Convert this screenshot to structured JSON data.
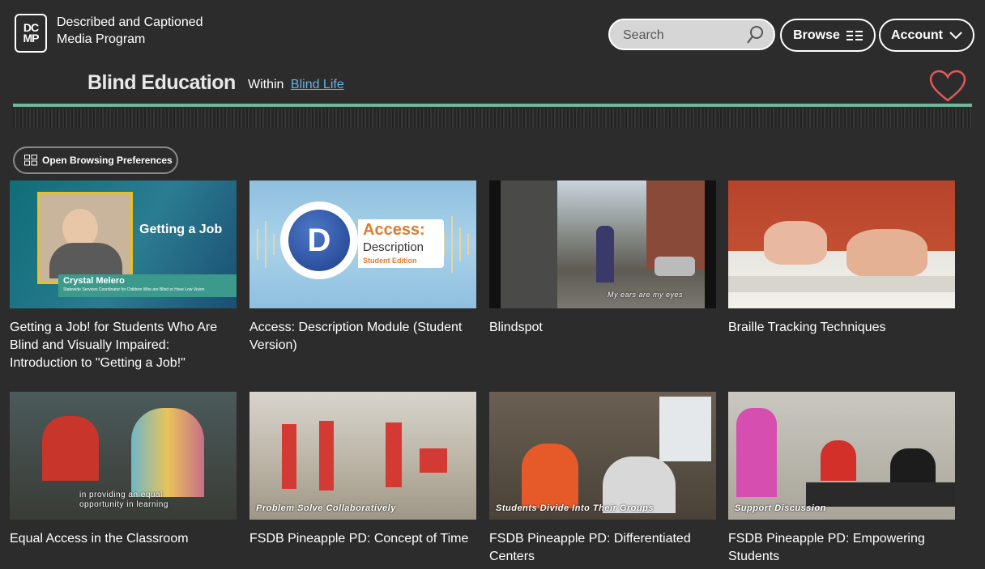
{
  "header": {
    "logo_letters": [
      "DC",
      "MP"
    ],
    "site_name": "Described and Captioned Media Program",
    "search_placeholder": "Search",
    "browse_label": "Browse",
    "account_label": "Account"
  },
  "page": {
    "title": "Blind Education",
    "within_label": "Within",
    "within_link": "Blind Life"
  },
  "preferences_label": "Open Browsing Preferences",
  "videos": [
    {
      "title": "Getting a Job! for Students Who Are Blind and Visually Impaired: Introduction to \"Getting a Job!\"",
      "thumb_text": "Getting a Job",
      "thumb_name": "Crystal Melero",
      "thumb_role": "Statewide Services Coordinator for Children Who are Blind or Have Low Vision"
    },
    {
      "title": "Access: Description Module (Student Version)",
      "thumb_text": "Access:",
      "thumb_sub": "Description",
      "thumb_edition": "Student Edition"
    },
    {
      "title": "Blindspot",
      "thumb_caption": "My ears are my eyes"
    },
    {
      "title": "Braille Tracking Techniques"
    },
    {
      "title": "Equal Access in the Classroom",
      "thumb_caption": "in providing an equal opportunity in learning"
    },
    {
      "title": "FSDB Pineapple PD: Concept of Time",
      "thumb_caption": "Problem Solve Collaboratively"
    },
    {
      "title": "FSDB Pineapple PD: Differentiated Centers",
      "thumb_caption": "Students Divide Into Their Groups"
    },
    {
      "title": "FSDB Pineapple PD: Empowering Students",
      "thumb_caption": "Support Discussion"
    }
  ],
  "colors": {
    "background": "#2d2c2c",
    "accent_rule": "#6fb89c",
    "link": "#5fb5e0",
    "heart": "#e05a5a"
  }
}
